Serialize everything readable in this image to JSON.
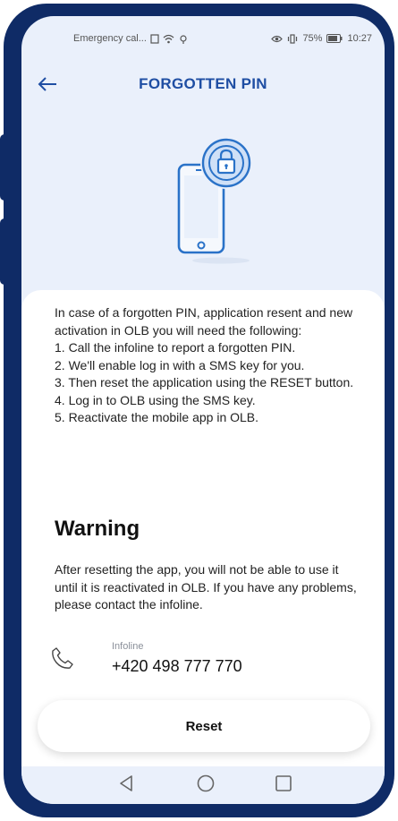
{
  "status_bar": {
    "carrier": "Emergency cal...",
    "battery": "75%",
    "time": "10:27"
  },
  "header": {
    "back_icon": "arrow-left-icon",
    "title": "FORGOTTEN PIN"
  },
  "illustration": {
    "icon": "phone-lock-icon"
  },
  "intro": {
    "text": "In case of a forgotten PIN, application resent and new activation in OLB you will need the following:",
    "steps": [
      "1. Call the infoline to report a forgotten PIN.",
      "2. We'll enable log in with a SMS key for you.",
      "3. Then reset the application using the RESET button.",
      "4. Log in to OLB using the SMS key.",
      "5. Reactivate the mobile app in OLB."
    ]
  },
  "warning": {
    "title": "Warning",
    "text": "After resetting the app, you will not be able to use it until it is reactivated in OLB. If you have any problems, please contact the infoline."
  },
  "infoline": {
    "icon": "phone-icon",
    "label": "Infoline",
    "number": "+420 498 777 770"
  },
  "reset_button": {
    "label": "Reset"
  },
  "navbar": {
    "icons": [
      "back-triangle-icon",
      "home-circle-icon",
      "recents-square-icon"
    ]
  },
  "colors": {
    "frame": "#0f2b66",
    "accent": "#1f4ea3",
    "screen_bg": "#eaf0fb"
  }
}
